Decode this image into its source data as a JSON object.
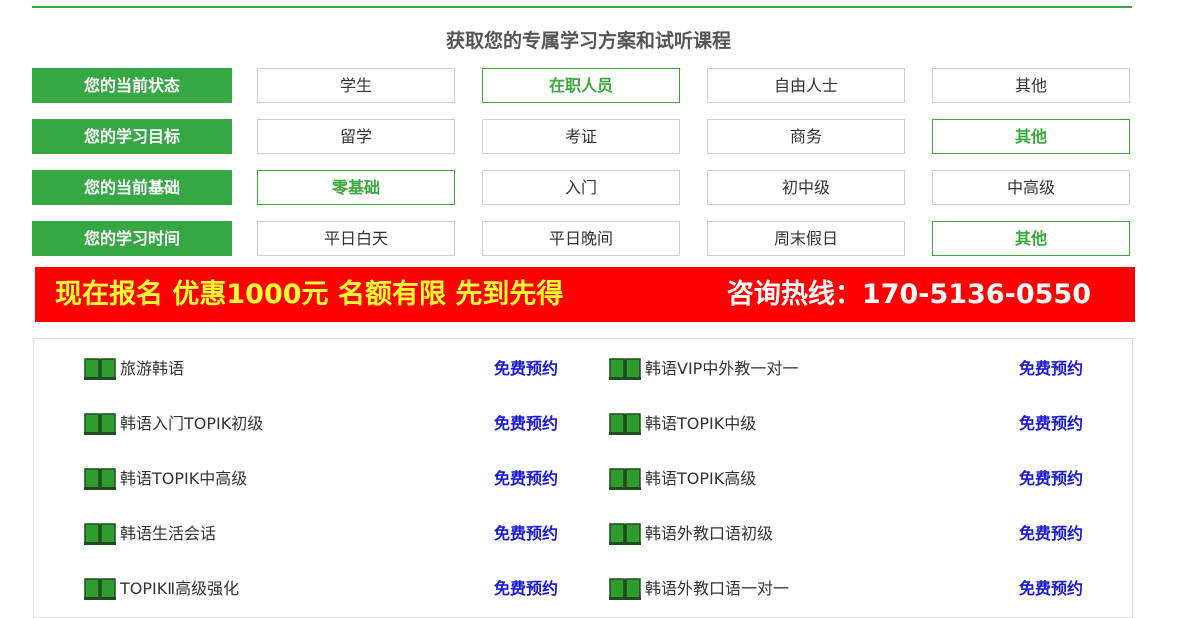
{
  "heading": "获取您的专属学习方案和试听课程",
  "form": {
    "rows": [
      {
        "label": "您的当前状态",
        "options": [
          "学生",
          "在职人员",
          "自由人士",
          "其他"
        ],
        "selected": 1
      },
      {
        "label": "您的学习目标",
        "options": [
          "留学",
          "考证",
          "商务",
          "其他"
        ],
        "selected": 3
      },
      {
        "label": "您的当前基础",
        "options": [
          "零基础",
          "入门",
          "初中级",
          "中高级"
        ],
        "selected": 0
      },
      {
        "label": "您的学习时间",
        "options": [
          "平日白天",
          "平日晚间",
          "周末假日",
          "其他"
        ],
        "selected": 3
      }
    ]
  },
  "banner": {
    "promo": "现在报名 优惠1000元 名额有限 先到先得",
    "hotline": "咨询热线：170-5136-0550"
  },
  "courses": {
    "left": [
      "旅游韩语",
      "韩语入门TOPIK初级",
      "韩语TOPIK中高级",
      "韩语生活会话",
      "TOPIKⅡ高级强化"
    ],
    "right": [
      "韩语VIP中外教一对一",
      "韩语TOPIK中级",
      "韩语TOPIK高级",
      "韩语外教口语初级",
      "韩语外教口语一对一"
    ],
    "reserve_label": "免费预约"
  },
  "colors": {
    "accent_green": "#36a843",
    "banner_red": "#fe0000",
    "promo_yellow": "#ffff33",
    "reserve_blue": "#1a1ad6"
  },
  "icons": {
    "course": "book-icon"
  }
}
